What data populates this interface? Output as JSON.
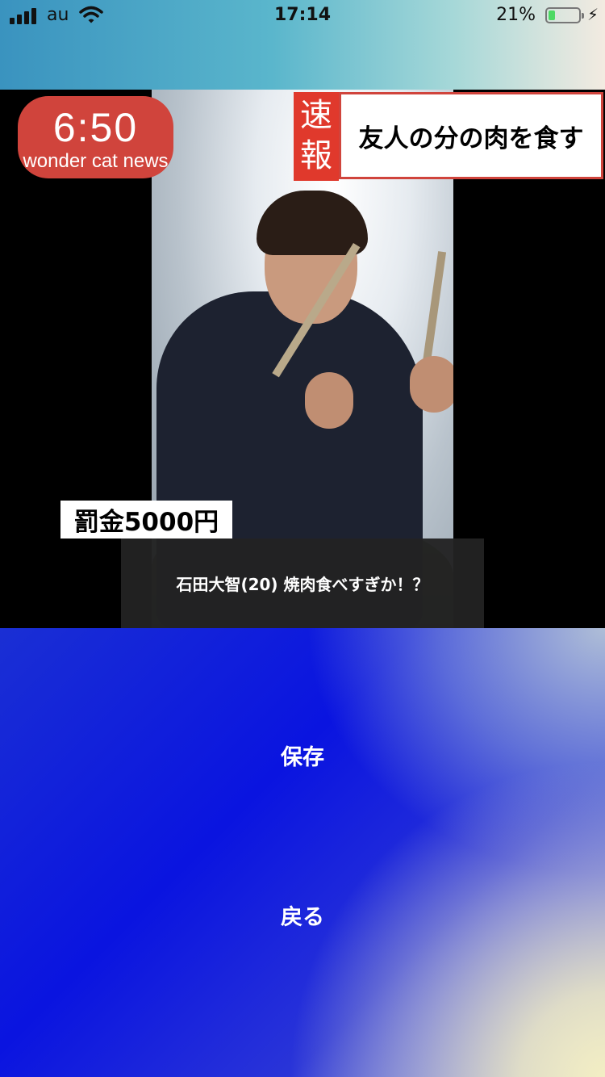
{
  "status_bar": {
    "carrier": "au",
    "time": "17:14",
    "battery_percent": "21%",
    "battery_level": 0.21,
    "icons": [
      "signal-icon",
      "wifi-icon",
      "battery-icon",
      "charging-bolt-icon"
    ]
  },
  "news": {
    "time_badge": {
      "time": "6:50",
      "brand": "wonder cat news"
    },
    "breaking_tag": "速報",
    "headline": "友人の分の肉を食す",
    "fine_label": "罰金5000円",
    "caption": "石田大智(20) 焼肉食べすぎか！？",
    "colors": {
      "badge_red": "#d0443c",
      "breaking_red": "#e0392c"
    }
  },
  "actions": {
    "save_label": "保存",
    "back_label": "戻る"
  }
}
